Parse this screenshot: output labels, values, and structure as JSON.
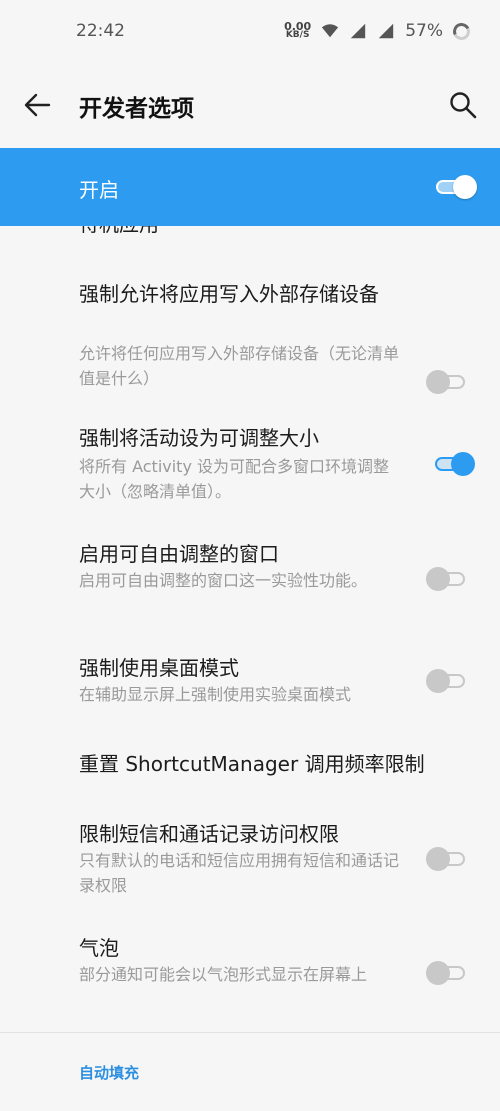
{
  "status_bar": {
    "time": "22:42",
    "net_speed_value": "0.00",
    "net_speed_unit": "KB/S",
    "battery": "57%"
  },
  "app_bar": {
    "title": "开发者选项"
  },
  "master_switch": {
    "label": "开启",
    "state": "on"
  },
  "list": {
    "partial_title": "待机应用",
    "items": [
      {
        "title": "强制允许将应用写入外部存储设备",
        "subtitle": "允许将任何应用写入外部存储设备（无论清单值是什么）",
        "toggle": "off"
      },
      {
        "title": "强制将活动设为可调整大小",
        "subtitle": "将所有 Activity 设为可配合多窗口环境调整大小（忽略清单值）。",
        "toggle": "on"
      },
      {
        "title": "启用可自由调整的窗口",
        "subtitle": "启用可自由调整的窗口这一实验性功能。",
        "toggle": "off"
      },
      {
        "title": "强制使用桌面模式",
        "subtitle": "在辅助显示屏上强制使用实验桌面模式",
        "toggle": "off"
      },
      {
        "title": "重置 ShortcutManager 调用频率限制"
      },
      {
        "title": "限制短信和通话记录访问权限",
        "subtitle": "只有默认的电话和短信应用拥有短信和通话记录权限",
        "toggle": "off"
      },
      {
        "title": "气泡",
        "subtitle": "部分通知可能会以气泡形式显示在屏幕上",
        "toggle": "off"
      }
    ]
  },
  "section": {
    "header": "自动填充"
  },
  "colors": {
    "accent": "#2d9cf0",
    "background": "#f6f6f6",
    "toggle_off": "#c8c8c8"
  }
}
